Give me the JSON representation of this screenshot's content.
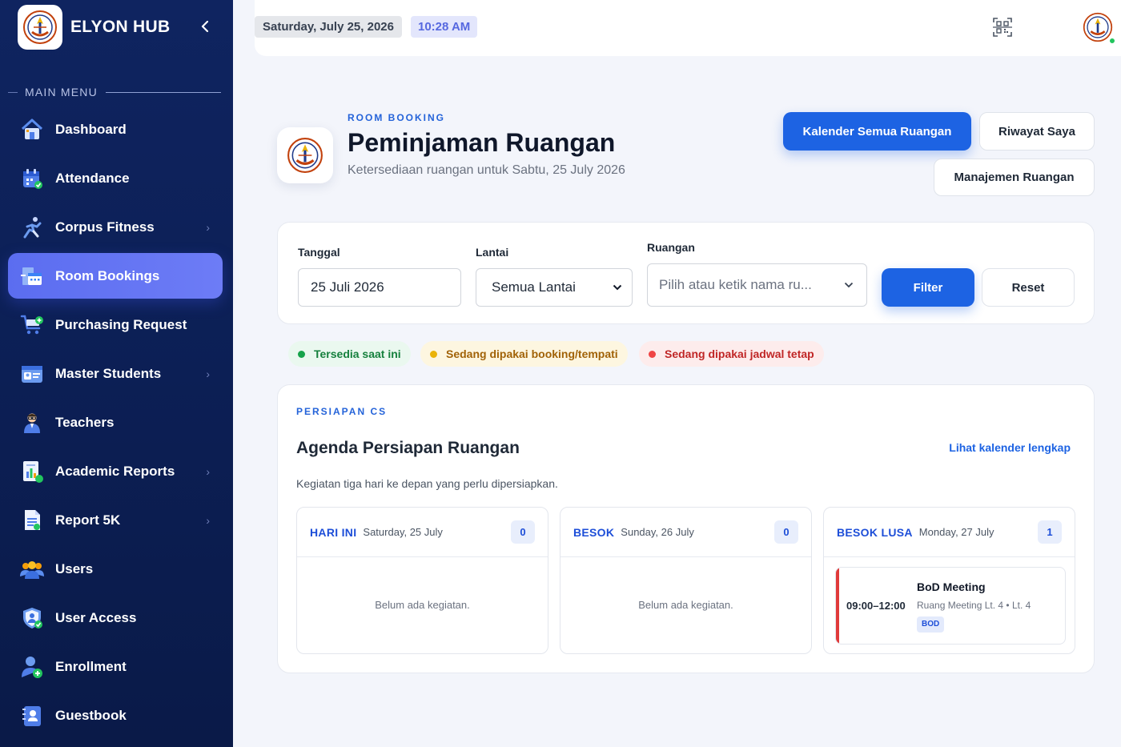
{
  "sidebar": {
    "brand": "ELYON HUB",
    "caption": "MAIN MENU",
    "items": [
      {
        "label": "Dashboard",
        "icon": "home-icon",
        "chevron": false,
        "active": false
      },
      {
        "label": "Attendance",
        "icon": "calendar-check-icon",
        "chevron": false,
        "active": false
      },
      {
        "label": "Corpus Fitness",
        "icon": "runner-icon",
        "chevron": true,
        "active": false
      },
      {
        "label": "Room Bookings",
        "icon": "room-calendar-icon",
        "chevron": false,
        "active": true
      },
      {
        "label": "Purchasing Request",
        "icon": "cart-icon",
        "chevron": false,
        "active": false
      },
      {
        "label": "Master Students",
        "icon": "id-card-icon",
        "chevron": true,
        "active": false
      },
      {
        "label": "Teachers",
        "icon": "teacher-icon",
        "chevron": false,
        "active": false
      },
      {
        "label": "Academic Reports",
        "icon": "report-chart-icon",
        "chevron": true,
        "active": false
      },
      {
        "label": "Report 5K",
        "icon": "document-icon",
        "chevron": true,
        "active": false
      },
      {
        "label": "Users",
        "icon": "users-icon",
        "chevron": false,
        "active": false
      },
      {
        "label": "User Access",
        "icon": "shield-user-icon",
        "chevron": false,
        "active": false
      },
      {
        "label": "Enrollment",
        "icon": "user-plus-icon",
        "chevron": false,
        "active": false
      },
      {
        "label": "Guestbook",
        "icon": "guestbook-icon",
        "chevron": false,
        "active": false
      }
    ]
  },
  "topbar": {
    "date": "Saturday, July 25, 2026",
    "time": "10:28 AM"
  },
  "header": {
    "eyebrow": "ROOM BOOKING",
    "title": "Peminjaman Ruangan",
    "subtitle": "Ketersediaan ruangan untuk Sabtu, 25 July 2026",
    "btn_calendar": "Kalender Semua Ruangan",
    "btn_history": "Riwayat Saya",
    "btn_manage": "Manajemen Ruangan"
  },
  "filter": {
    "date_label": "Tanggal",
    "date_value": "25 Juli 2026",
    "floor_label": "Lantai",
    "floor_value": "Semua Lantai",
    "room_label": "Ruangan",
    "room_placeholder": "Pilih atau ketik nama ru...",
    "filter_btn": "Filter",
    "reset_btn": "Reset"
  },
  "legend": [
    {
      "label": "Tersedia saat ini",
      "color": "#16a34a",
      "bg": "#eaf8ef",
      "text": "#15803d"
    },
    {
      "label": "Sedang dipakai booking/tempati",
      "color": "#eab308",
      "bg": "#fdf6e0",
      "text": "#a16207"
    },
    {
      "label": "Sedang dipakai jadwal tetap",
      "color": "#ef4444",
      "bg": "#fdecec",
      "text": "#c02626"
    }
  ],
  "agenda": {
    "eyebrow": "PERSIAPAN CS",
    "title": "Agenda Persiapan Ruangan",
    "link": "Lihat kalender lengkap",
    "subtitle": "Kegiatan tiga hari ke depan yang perlu dipersiapkan.",
    "empty_text": "Belum ada kegiatan.",
    "days": [
      {
        "tag": "HARI INI",
        "date": "Saturday, 25 July",
        "count": "0"
      },
      {
        "tag": "BESOK",
        "date": "Sunday, 26 July",
        "count": "0"
      },
      {
        "tag": "BESOK LUSA",
        "date": "Monday, 27 July",
        "count": "1"
      }
    ],
    "event": {
      "time": "09:00–12:00",
      "title": "BoD Meeting",
      "room": "Ruang Meeting Lt. 4 • Lt. 4",
      "tag": "BOD"
    }
  },
  "colors": {
    "accent": "#1d63e3",
    "sidebar_bg": "#0f2460",
    "active_item": "#5b6df0",
    "online": "#22c55e"
  }
}
